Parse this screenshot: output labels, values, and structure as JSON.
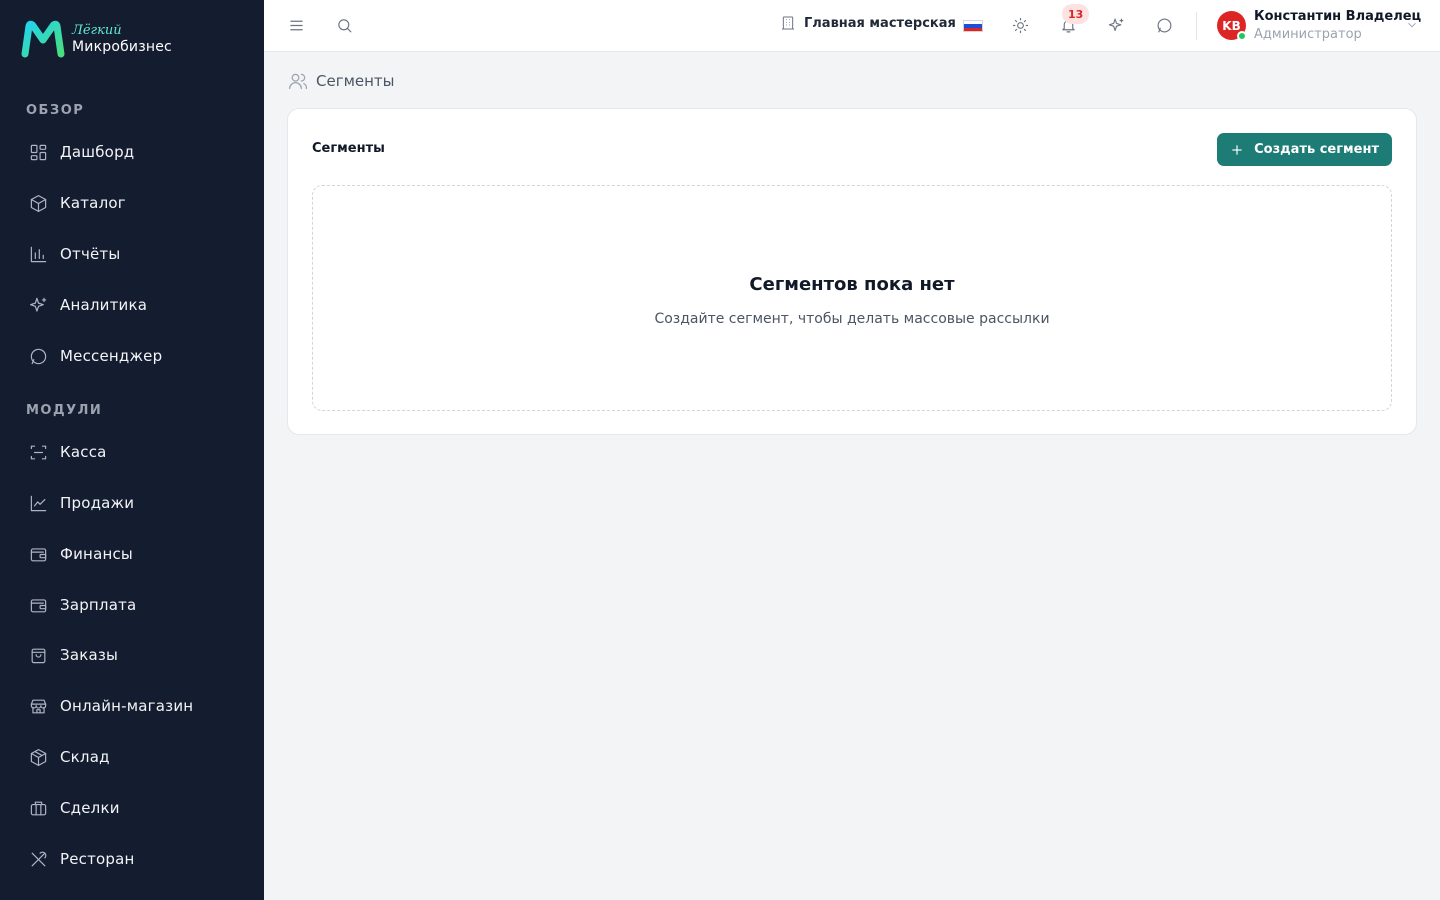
{
  "brand": {
    "top": "Лёгкий",
    "bottom": "Микробизнес"
  },
  "sidebar": {
    "sections": [
      {
        "title": "ОБЗОР"
      },
      {
        "title": "МОДУЛИ"
      }
    ],
    "items": [
      {
        "label": "Дашборд",
        "icon": "dashboard-icon"
      },
      {
        "label": "Каталог",
        "icon": "catalog-icon"
      },
      {
        "label": "Отчёты",
        "icon": "bar-chart-icon"
      },
      {
        "label": "Аналитика",
        "icon": "sparkles-icon"
      },
      {
        "label": "Мессенджер",
        "icon": "chat-icon"
      },
      {
        "label": "Касса",
        "icon": "scan-icon"
      },
      {
        "label": "Продажи",
        "icon": "line-chart-icon"
      },
      {
        "label": "Финансы",
        "icon": "wallet-icon"
      },
      {
        "label": "Зарплата",
        "icon": "wallet-icon"
      },
      {
        "label": "Заказы",
        "icon": "shopping-bag-icon"
      },
      {
        "label": "Онлайн-магазин",
        "icon": "store-icon"
      },
      {
        "label": "Склад",
        "icon": "package-icon"
      },
      {
        "label": "Сделки",
        "icon": "briefcase-icon"
      },
      {
        "label": "Ресторан",
        "icon": "utensils-icon"
      }
    ]
  },
  "topbar": {
    "workshop": "Главная мастерская",
    "language_flag": "ru",
    "notifications_count": "13",
    "user": {
      "initials": "KB",
      "name": "Константин Владелец",
      "role": "Администратор"
    }
  },
  "breadcrumb": {
    "label": "Сегменты"
  },
  "main": {
    "card_title": "Сегменты",
    "create_button": "Создать сегмент",
    "empty_title": "Сегментов пока нет",
    "empty_subtitle": "Создайте сегмент, чтобы делать массовые рассылки"
  },
  "colors": {
    "sidebar_bg": "#141c30",
    "accent": "#1e7c76",
    "badge_bg": "#fde2e2",
    "badge_text": "#dc2626",
    "avatar": "#dc2626"
  }
}
